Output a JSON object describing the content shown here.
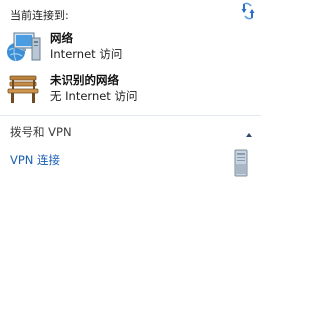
{
  "header": {
    "title": "当前连接到:"
  },
  "icons": {
    "refresh": "refresh-arrows-icon",
    "network": "network-computer-icon",
    "unidentified": "park-bench-icon",
    "collapse": "chevron-up-icon",
    "vpn": "vpn-server-icon"
  },
  "connections": [
    {
      "name": "网络",
      "status": "Internet 访问"
    },
    {
      "name": "未识别的网络",
      "status": "无 Internet 访问"
    }
  ],
  "vpn_section": {
    "title": "拨号和 VPN",
    "items": [
      {
        "label": "VPN 连接"
      }
    ]
  },
  "colors": {
    "link": "#1a5fb4",
    "divider": "#e3e8ee",
    "background": "#ffffff"
  }
}
